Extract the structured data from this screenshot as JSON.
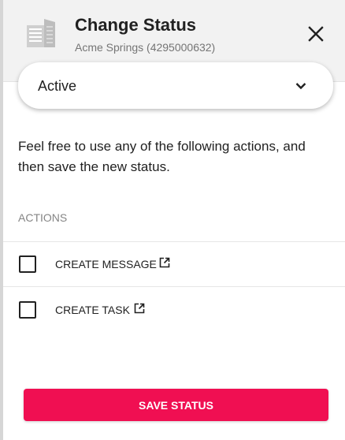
{
  "header": {
    "title": "Change Status",
    "subtitle": "Acme Springs (4295000632)",
    "icon": "building-icon",
    "close_icon": "close-icon"
  },
  "status_select": {
    "value": "Active",
    "icon": "chevron-down-icon"
  },
  "description": "Feel free to use any of the following actions, and then save the new status.",
  "actions": {
    "heading": "ACTIONS",
    "items": [
      {
        "label": "CREATE MESSAGE",
        "checked": false,
        "icon": "external-link-icon"
      },
      {
        "label": "CREATE TASK",
        "checked": false,
        "icon": "external-link-icon"
      }
    ]
  },
  "save_button": {
    "label": "SAVE STATUS",
    "color": "#f00f52"
  },
  "colors": {
    "header_bg": "#f2f2f2",
    "accent": "#f00f52",
    "muted_text": "#757575"
  }
}
